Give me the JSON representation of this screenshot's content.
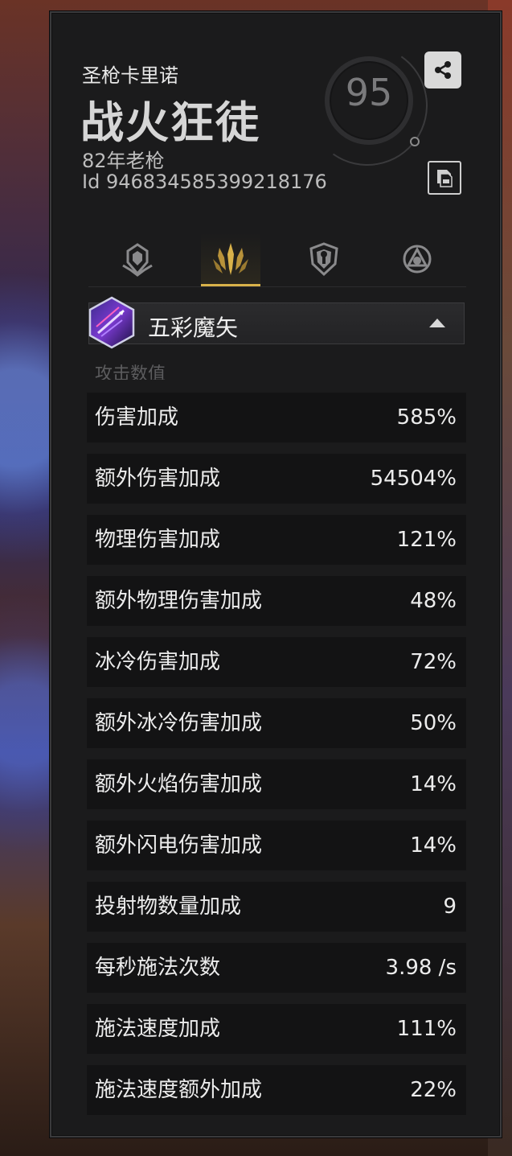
{
  "profile": {
    "subtitle": "圣枪卡里诺",
    "name": "战火狂徒",
    "guild": "82年老枪",
    "id_line": "Id 946834585399218176",
    "level": "95"
  },
  "icons": {
    "share": "share-icon",
    "copy": "copy-icon",
    "tabs": [
      "helmet-icon",
      "weapon-flames-icon",
      "shield-icon",
      "circle-triangle-icon"
    ]
  },
  "tabs": {
    "active_index": 1
  },
  "skill_selector": {
    "label": "五彩魔矢",
    "icon": "magic-arrow-skill-icon"
  },
  "section_title": "攻击数值",
  "stats": [
    {
      "label": "伤害加成",
      "value": "585%"
    },
    {
      "label": "额外伤害加成",
      "value": "54504%"
    },
    {
      "label": "物理伤害加成",
      "value": "121%"
    },
    {
      "label": "额外物理伤害加成",
      "value": "48%"
    },
    {
      "label": "冰冷伤害加成",
      "value": "72%"
    },
    {
      "label": "额外冰冷伤害加成",
      "value": "50%"
    },
    {
      "label": "额外火焰伤害加成",
      "value": "14%"
    },
    {
      "label": "额外闪电伤害加成",
      "value": "14%"
    },
    {
      "label": "投射物数量加成",
      "value": "9"
    },
    {
      "label": "每秒施法次数",
      "value": "3.98 /s"
    },
    {
      "label": "施法速度加成",
      "value": "111%"
    },
    {
      "label": "施法速度额外加成",
      "value": "22%"
    }
  ],
  "colors": {
    "accent": "#d9b24a",
    "panel": "#1b1b1c",
    "row": "#131314"
  }
}
